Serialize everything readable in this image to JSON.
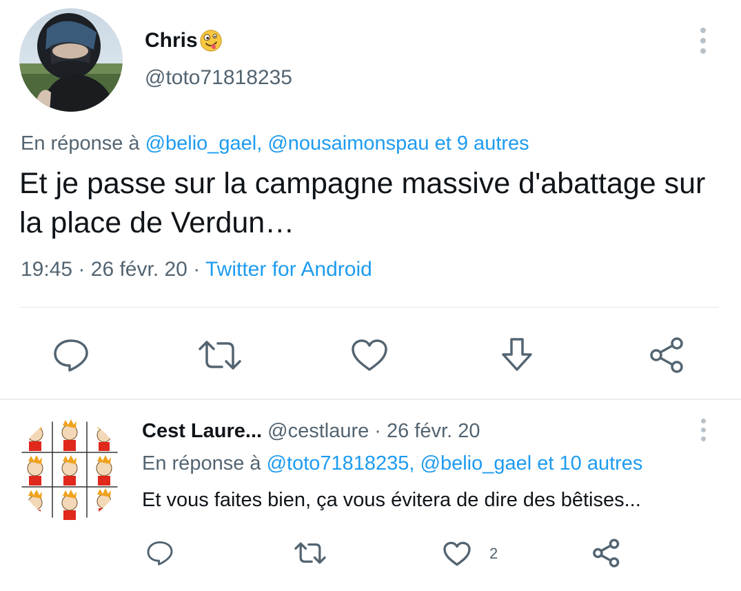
{
  "main_tweet": {
    "display_name": "Chris",
    "name_emoji": "zany-face-emoji",
    "handle": "@toto71818235",
    "reply_to_prefix": "En réponse à ",
    "reply_to_users": "@belio_gael, @nousaimonspau",
    "reply_to_joiner": " et ",
    "reply_to_others": "9 autres",
    "text": "Et je passe sur la campagne massive d'abattage sur la place de Verdun…",
    "time": "19:45",
    "date": "26 févr. 20",
    "dot": "·",
    "source": "Twitter for Android",
    "actions": [
      "reply-icon",
      "retweet-icon",
      "like-icon",
      "download-icon",
      "share-icon"
    ]
  },
  "reply_tweet": {
    "display_name": "Cest Laure...",
    "handle": "@cestlaure",
    "dot": " · ",
    "date": "26 févr. 20",
    "reply_to_prefix": "En réponse à ",
    "reply_to_users": "@toto71818235, @belio_gael",
    "reply_to_joiner": " et ",
    "reply_to_others": "10 autres",
    "text": "Et vous faites bien, ça vous évitera de dire des bêtises...",
    "like_count": "2",
    "actions": [
      "reply-icon",
      "retweet-icon",
      "like-icon",
      "share-icon"
    ]
  },
  "colors": {
    "text": "#0f1419",
    "secondary": "#536471",
    "link": "#1d9bf0",
    "divider": "#e1e6ea",
    "icon": "#536471"
  }
}
